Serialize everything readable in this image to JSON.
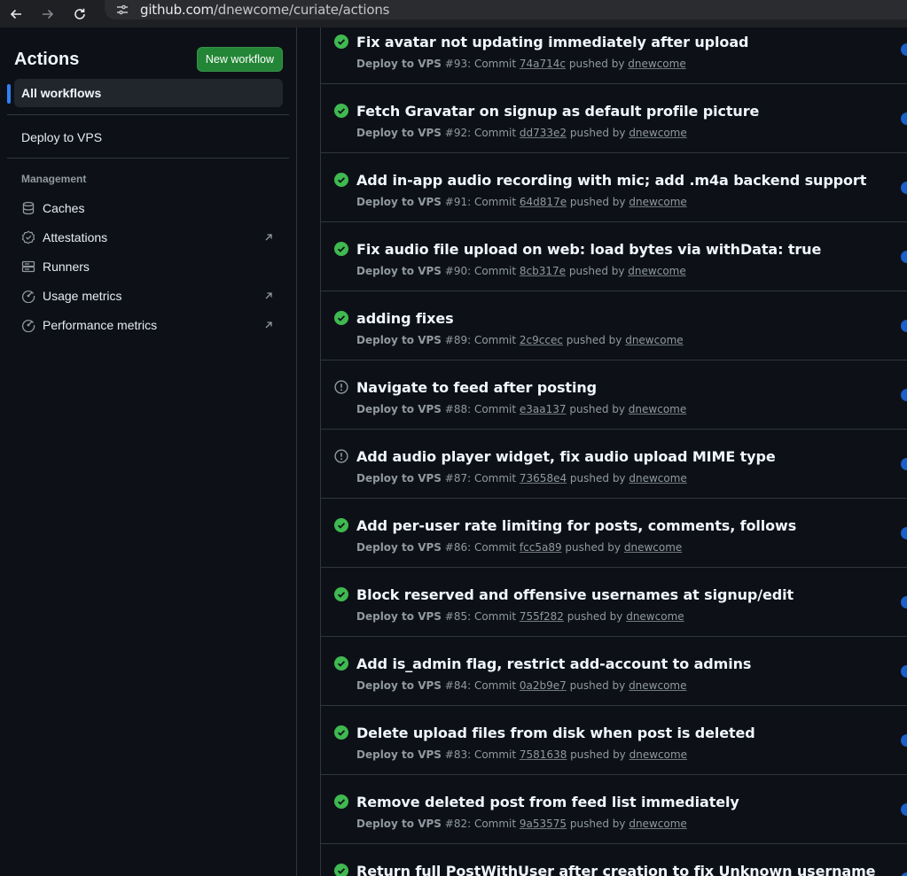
{
  "browser": {
    "url_host": "github.com",
    "url_path": "/dnewcome/curiate/actions"
  },
  "sidebar": {
    "title": "Actions",
    "new_workflow_label": "New workflow",
    "all_workflows_label": "All workflows",
    "workflows": [
      {
        "label": "Deploy to VPS"
      }
    ],
    "management_heading": "Management",
    "management_items": [
      {
        "label": "Caches",
        "icon": "database-icon",
        "external": false
      },
      {
        "label": "Attestations",
        "icon": "verified-icon",
        "external": true
      },
      {
        "label": "Runners",
        "icon": "server-icon",
        "external": false
      },
      {
        "label": "Usage metrics",
        "icon": "meter-icon",
        "external": true
      },
      {
        "label": "Performance metrics",
        "icon": "meter-icon",
        "external": true
      }
    ]
  },
  "colors": {
    "success": "#3fb950",
    "neutral": "#9198a1",
    "primary_button": "#238636",
    "accent": "#2f81f7"
  },
  "runs": [
    {
      "title": "Fix avatar not updating immediately after upload",
      "workflow": "Deploy to VPS",
      "run_number": "#93",
      "commit_prefix": ": Commit ",
      "commit": "74a714c",
      "pushed_by": " pushed by ",
      "user": "dnewcome",
      "status": "success"
    },
    {
      "title": "Fetch Gravatar on signup as default profile picture",
      "workflow": "Deploy to VPS",
      "run_number": "#92",
      "commit_prefix": ": Commit ",
      "commit": "dd733e2",
      "pushed_by": " pushed by ",
      "user": "dnewcome",
      "status": "success"
    },
    {
      "title": "Add in-app audio recording with mic; add .m4a backend support",
      "workflow": "Deploy to VPS",
      "run_number": "#91",
      "commit_prefix": ": Commit ",
      "commit": "64d817e",
      "pushed_by": " pushed by ",
      "user": "dnewcome",
      "status": "success"
    },
    {
      "title": "Fix audio file upload on web: load bytes via withData: true",
      "workflow": "Deploy to VPS",
      "run_number": "#90",
      "commit_prefix": ": Commit ",
      "commit": "8cb317e",
      "pushed_by": " pushed by ",
      "user": "dnewcome",
      "status": "success"
    },
    {
      "title": "adding fixes",
      "workflow": "Deploy to VPS",
      "run_number": "#89",
      "commit_prefix": ": Commit ",
      "commit": "2c9ccec",
      "pushed_by": " pushed by ",
      "user": "dnewcome",
      "status": "success"
    },
    {
      "title": "Navigate to feed after posting",
      "workflow": "Deploy to VPS",
      "run_number": "#88",
      "commit_prefix": ": Commit ",
      "commit": "e3aa137",
      "pushed_by": " pushed by ",
      "user": "dnewcome",
      "status": "neutral"
    },
    {
      "title": "Add audio player widget, fix audio upload MIME type",
      "workflow": "Deploy to VPS",
      "run_number": "#87",
      "commit_prefix": ": Commit ",
      "commit": "73658e4",
      "pushed_by": " pushed by ",
      "user": "dnewcome",
      "status": "neutral"
    },
    {
      "title": "Add per-user rate limiting for posts, comments, follows",
      "workflow": "Deploy to VPS",
      "run_number": "#86",
      "commit_prefix": ": Commit ",
      "commit": "fcc5a89",
      "pushed_by": " pushed by ",
      "user": "dnewcome",
      "status": "success"
    },
    {
      "title": "Block reserved and offensive usernames at signup/edit",
      "workflow": "Deploy to VPS",
      "run_number": "#85",
      "commit_prefix": ": Commit ",
      "commit": "755f282",
      "pushed_by": " pushed by ",
      "user": "dnewcome",
      "status": "success"
    },
    {
      "title": "Add is_admin flag, restrict add-account to admins",
      "workflow": "Deploy to VPS",
      "run_number": "#84",
      "commit_prefix": ": Commit ",
      "commit": "0a2b9e7",
      "pushed_by": " pushed by ",
      "user": "dnewcome",
      "status": "success"
    },
    {
      "title": "Delete upload files from disk when post is deleted",
      "workflow": "Deploy to VPS",
      "run_number": "#83",
      "commit_prefix": ": Commit ",
      "commit": "7581638",
      "pushed_by": " pushed by ",
      "user": "dnewcome",
      "status": "success"
    },
    {
      "title": "Remove deleted post from feed list immediately",
      "workflow": "Deploy to VPS",
      "run_number": "#82",
      "commit_prefix": ": Commit ",
      "commit": "9a53575",
      "pushed_by": " pushed by ",
      "user": "dnewcome",
      "status": "success"
    },
    {
      "title": "Return full PostWithUser after creation to fix Unknown username",
      "workflow": "",
      "run_number": "",
      "commit_prefix": "",
      "commit": "",
      "pushed_by": "",
      "user": "",
      "status": "success"
    }
  ]
}
